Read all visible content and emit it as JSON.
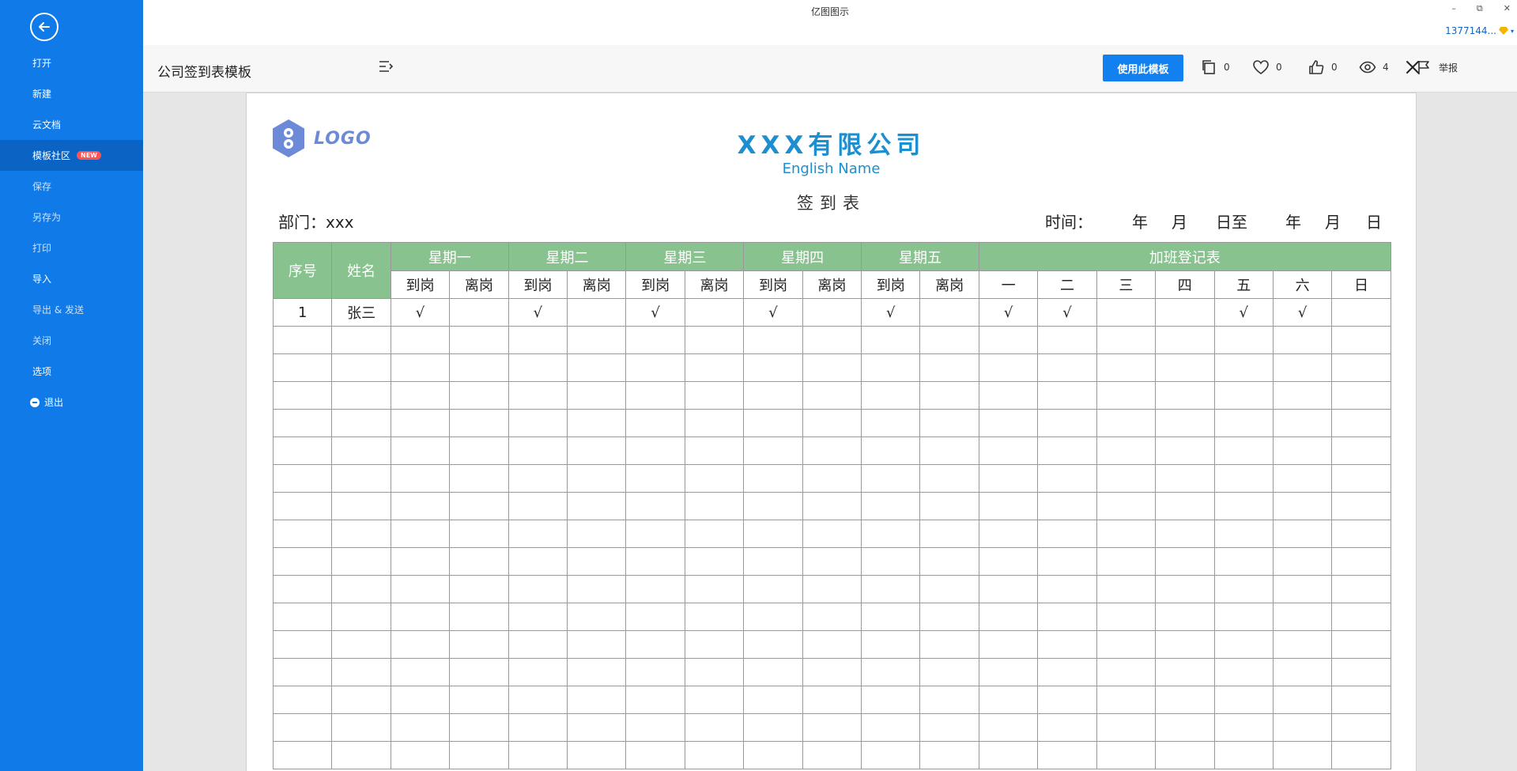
{
  "app": {
    "title": "亿图图示",
    "window_controls": [
      "–",
      "⧉",
      "✕"
    ],
    "user": "1377144..."
  },
  "sidebar": {
    "items": [
      {
        "label": "打开",
        "style": "normal"
      },
      {
        "label": "新建",
        "style": "normal"
      },
      {
        "label": "云文档",
        "style": "normal"
      },
      {
        "label": "模板社区",
        "style": "active",
        "badge": "NEW"
      },
      {
        "label": "保存",
        "style": "dim"
      },
      {
        "label": "另存为",
        "style": "dim"
      },
      {
        "label": "打印",
        "style": "dim"
      },
      {
        "label": "导入",
        "style": "normal"
      },
      {
        "label": "导出 & 发送",
        "style": "dim"
      },
      {
        "label": "关闭",
        "style": "dim"
      },
      {
        "label": "选项",
        "style": "normal"
      },
      {
        "label": "退出",
        "style": "normal",
        "icon": "minus-circle-icon"
      }
    ]
  },
  "toolbar": {
    "doc_title": "公司签到表模板",
    "use_template_label": "使用此模板",
    "stats": [
      {
        "icon": "copy-icon",
        "count": "0"
      },
      {
        "icon": "heart-icon",
        "count": "0"
      },
      {
        "icon": "thumbs-up-icon",
        "count": "0"
      },
      {
        "icon": "eye-icon",
        "count": "4"
      }
    ],
    "report_label": "举报"
  },
  "document": {
    "logo_text": "LOGO",
    "company": "XXX有限公司",
    "english_name": "English Name",
    "sheet_title": "签到表",
    "department": "部门：xxx",
    "time_label": "时间：",
    "date_words": [
      "年",
      "月",
      "日至",
      "年",
      "月",
      "日"
    ],
    "header": {
      "seq": "序号",
      "name": "姓名",
      "days": [
        "星期一",
        "星期二",
        "星期三",
        "星期四",
        "星期五"
      ],
      "overtime": "加班登记表",
      "sub_in": "到岗",
      "sub_out": "离岗",
      "overtime_days": [
        "一",
        "二",
        "三",
        "四",
        "五",
        "六",
        "日"
      ]
    },
    "rows": [
      {
        "seq": "1",
        "name": "张三",
        "cells": [
          "√",
          "",
          "√",
          "",
          "√",
          "",
          "√",
          "",
          "√",
          "",
          "√",
          "√",
          "",
          "",
          "√",
          "√",
          ""
        ]
      }
    ],
    "empty_rows": 16
  },
  "colors": {
    "sidebar": "#0f7ae8",
    "sidebar_active": "#0b63c4",
    "header_green": "#88c28e",
    "company_blue": "#1b8fcf",
    "button_blue": "#1380f0"
  }
}
